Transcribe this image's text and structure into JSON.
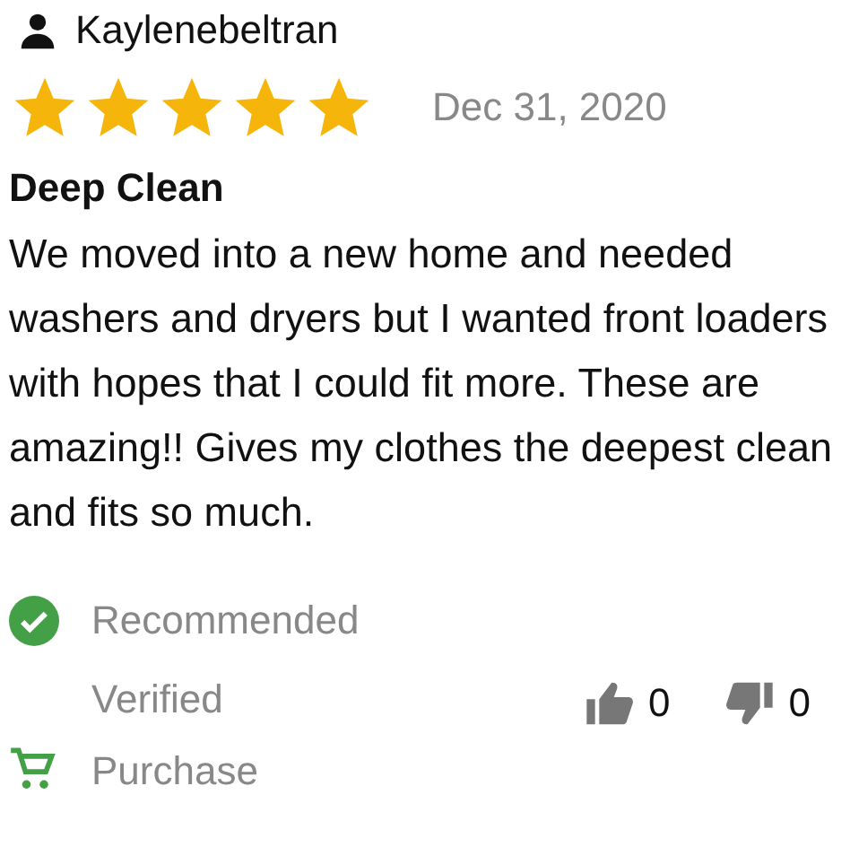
{
  "review": {
    "author": "Kaylenebeltran",
    "stars": 5,
    "date": "Dec 31, 2020",
    "title": "Deep Clean",
    "body": "We moved into a new home and needed washers and dryers but I wanted front loaders with hopes that I could fit more. These are amazing!! Gives my clothes the deepest clean and fits so much.",
    "recommended": "Recommended",
    "verified": "Verified Purchase",
    "helpful_count": "0",
    "unhelpful_count": "0"
  }
}
